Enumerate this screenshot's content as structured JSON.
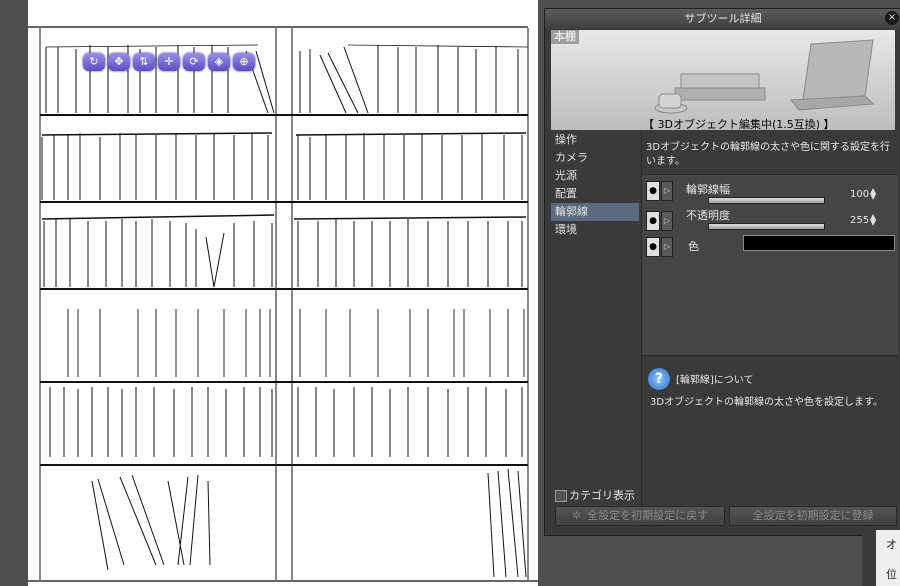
{
  "panel": {
    "title": "サブツール詳細",
    "close": "×",
    "preview_label": "本棚",
    "status": "【 3Dオブジェクト編集中(1.5互換) 】",
    "nav": [
      {
        "label": "操作"
      },
      {
        "label": "カメラ"
      },
      {
        "label": "光源"
      },
      {
        "label": "配置"
      },
      {
        "label": "輪郭線"
      },
      {
        "label": "環境"
      }
    ],
    "active_index": 4,
    "description": "3Dオブジェクトの輪郭線の太さや色に関する設定を行います。",
    "props": {
      "width_label": "輪郭線幅",
      "width_value": "100",
      "opacity_label": "不透明度",
      "opacity_value": "255",
      "color_label": "色",
      "color_value": "#000000"
    },
    "about_title": "[輪郭線]について",
    "about_body": "3Dオブジェクトの輪郭線の太さや色を設定します。",
    "category_label": "カテゴリ表示",
    "reset_button": "全設定を初期設定に戻す",
    "register_button": "全設定を初期設定に登録"
  },
  "gizmo": [
    {
      "icon": "rotate-camera-icon"
    },
    {
      "icon": "pan-camera-icon"
    },
    {
      "icon": "dolly-camera-icon"
    },
    {
      "icon": "move-object-icon"
    },
    {
      "icon": "rotate-object-icon"
    },
    {
      "icon": "scale-object-icon"
    },
    {
      "icon": "ground-move-icon"
    }
  ],
  "right_edge": {
    "char1": "オ",
    "char2": "位"
  }
}
